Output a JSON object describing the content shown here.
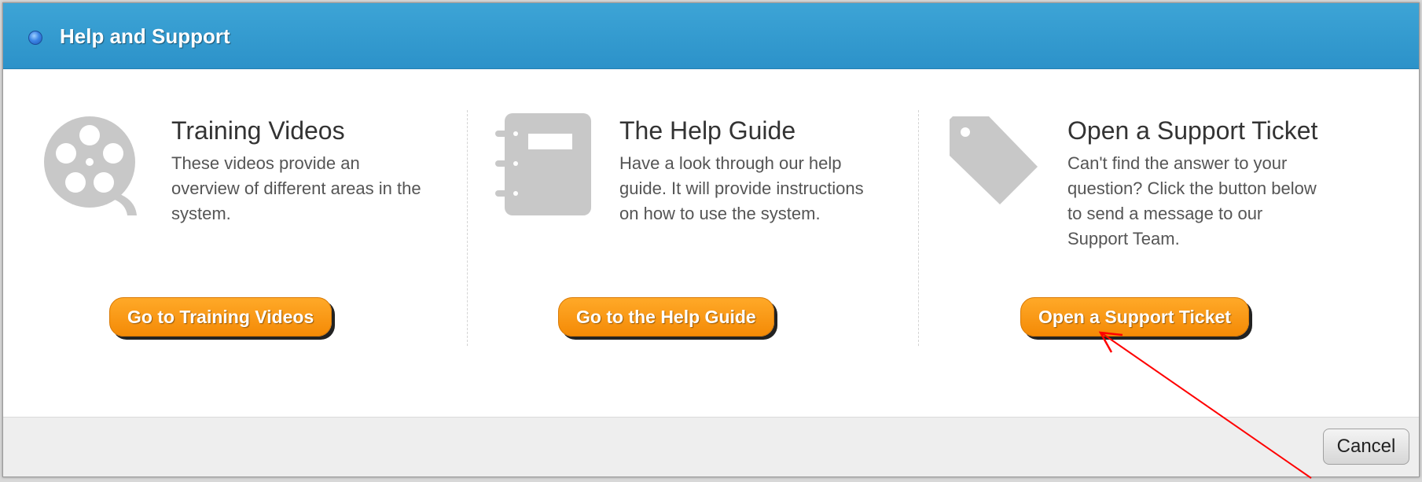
{
  "dialog": {
    "title": "Help and Support"
  },
  "columns": [
    {
      "icon": "film-reel-icon",
      "title": "Training Videos",
      "description": "These videos provide an overview of different areas in the system.",
      "button": "Go to Training Videos"
    },
    {
      "icon": "notebook-icon",
      "title": "The Help Guide",
      "description": "Have a look through our help guide. It will provide instructions on how to use the system.",
      "button": "Go to the Help Guide"
    },
    {
      "icon": "tag-icon",
      "title": "Open a Support Ticket",
      "description": "Can't find the answer to your question? Click the button below to send a message to our Support Team.",
      "button": "Open a Support Ticket"
    }
  ],
  "footer": {
    "cancel": "Cancel"
  },
  "colors": {
    "titlebar": "#3399cc",
    "button_accent": "#f7941d",
    "icon_gray": "#c8c8c8",
    "annotation_arrow": "#ff0000"
  }
}
